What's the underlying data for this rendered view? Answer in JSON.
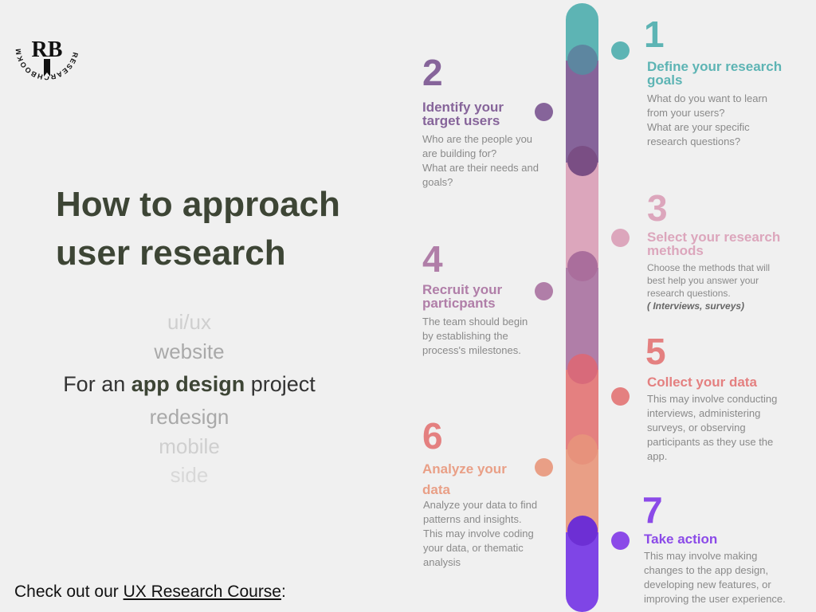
{
  "brand": {
    "logo_text": "RESEARCHBOOKMARK.IO",
    "logo_monogram": "RB"
  },
  "title": {
    "line1": "How to approach",
    "line2": "user research"
  },
  "project_types": {
    "above": [
      "ui/ux",
      "website"
    ],
    "prefix": "For an ",
    "highlight": "app design",
    "suffix": " project",
    "below": [
      "redesign",
      "mobile",
      "side"
    ]
  },
  "cta": {
    "prefix": "Check out our ",
    "link": "UX Research Course",
    "suffix": ":"
  },
  "steps": [
    {
      "number": "1",
      "heading_lines": [
        "Define your research",
        "goals"
      ],
      "desc_lines": [
        "What do you want to learn",
        "from your users?",
        "What are your specific",
        "research questions?"
      ],
      "color": "#5db4b4"
    },
    {
      "number": "2",
      "heading_lines": [
        "Identify your",
        "target users"
      ],
      "desc_lines": [
        "Who are the people you",
        "are building for?",
        "What are their needs and",
        "goals?"
      ],
      "color": "#86649a"
    },
    {
      "number": "3",
      "heading_lines": [
        "Select your research",
        "methods"
      ],
      "desc_lines": [
        "Choose the methods that will",
        "best help you answer your",
        "research questions."
      ],
      "desc_note": "( Interviews, surveys)",
      "color": "#dca6bc"
    },
    {
      "number": "4",
      "heading_lines": [
        "Recruit your",
        "particpants"
      ],
      "desc_lines": [
        "The team should begin",
        "by establishing the",
        "process's milestones."
      ],
      "color": "#b07ea8"
    },
    {
      "number": "5",
      "heading_lines": [
        "Collect your data"
      ],
      "desc_lines": [
        "This may involve conducting",
        "interviews, administering",
        "surveys, or observing",
        "participants as they use the",
        "app."
      ],
      "color": "#e48080"
    },
    {
      "number": "6",
      "heading_lines": [
        "Analyze your",
        "data"
      ],
      "desc_lines": [
        "Analyze your data to find",
        "patterns and insights.",
        "This may involve coding",
        "your data, or thematic",
        "analysis"
      ],
      "color": "#e99f86"
    },
    {
      "number": "7",
      "heading_lines": [
        "Take action"
      ],
      "desc_lines": [
        "This may involve making",
        "changes to the app design,",
        "developing new features, or",
        "improving the user experience."
      ],
      "color": "#8b4ae8"
    }
  ]
}
